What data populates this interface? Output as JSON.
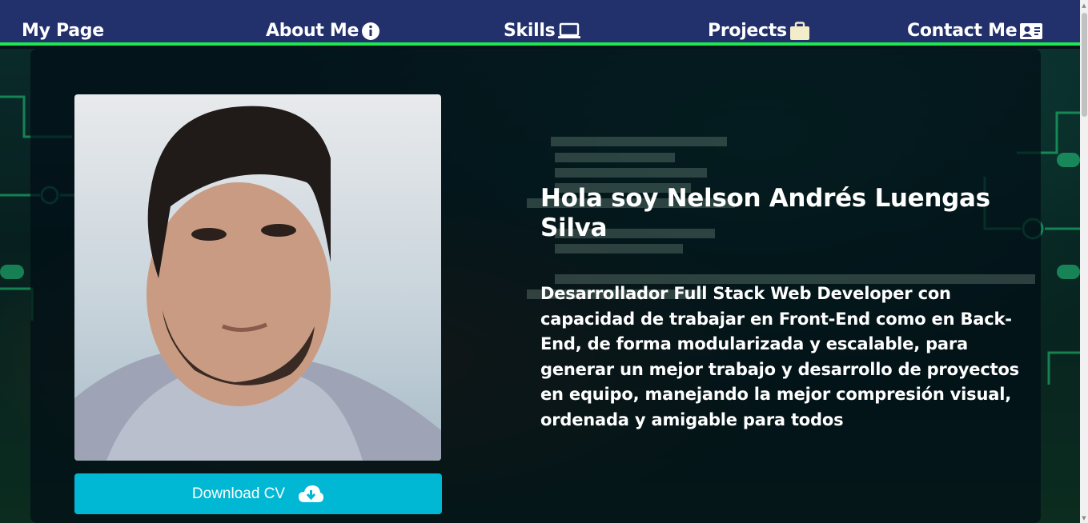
{
  "nav": {
    "brand": "My Page",
    "items": [
      {
        "label": "About Me",
        "icon": "info-icon"
      },
      {
        "label": "Skills",
        "icon": "laptop-icon"
      },
      {
        "label": "Projects",
        "icon": "briefcase-icon"
      },
      {
        "label": "Contact Me",
        "icon": "contact-card-icon"
      }
    ]
  },
  "hero": {
    "title": "Hola soy Nelson Andrés Luengas Silva",
    "description": "Desarrollador Full Stack Web Developer con capacidad de trabajar en Front-End como en Back-End, de forma modularizada y escalable, para generar un mejor trabajo y desarrollo de proyectos en equipo, manejando la mejor compresión visual, ordenada y amigable para todos",
    "download_label": "Download CV",
    "download_icon": "cloud-download-icon"
  },
  "colors": {
    "navbar": "#22306b",
    "accent_line": "#1ee84f",
    "button": "#00b7d4"
  }
}
